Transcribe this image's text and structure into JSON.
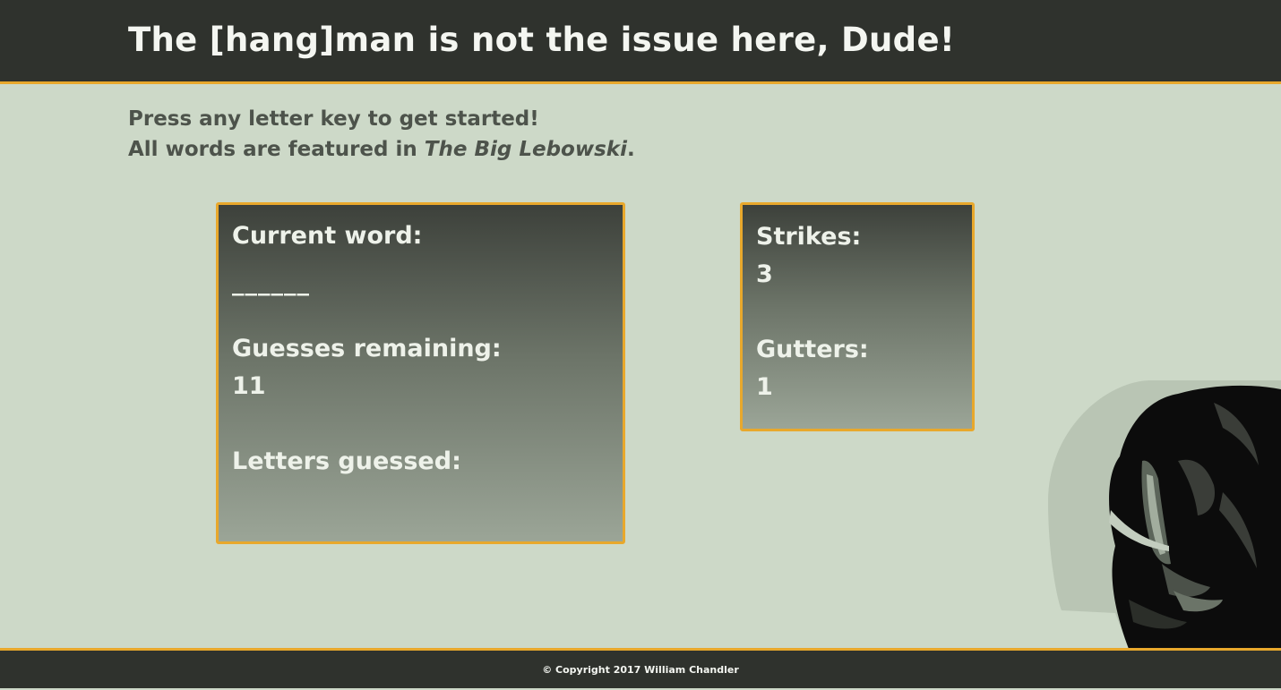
{
  "header": {
    "title": "The [hang]man is not the issue here, Dude!"
  },
  "intro": {
    "line1": "Press any letter key to get started!",
    "line2_prefix": "All words are featured in ",
    "line2_movie": "The Big Lebowski",
    "line2_suffix": "."
  },
  "game": {
    "current_word_label": "Current word:",
    "current_word_value": "______",
    "guesses_remaining_label": "Guesses remaining:",
    "guesses_remaining_value": "11",
    "letters_guessed_label": "Letters guessed:",
    "letters_guessed_value": ""
  },
  "stats": {
    "strikes_label": "Strikes:",
    "strikes_value": "3",
    "gutters_label": "Gutters:",
    "gutters_value": "1"
  },
  "footer": {
    "copyright": "© Copyright 2017 William Chandler"
  },
  "colors": {
    "background": "#cdd9c8",
    "header_bg": "#2f322d",
    "accent": "#e8a82c",
    "card_text": "#eef2ea",
    "intro_text": "#4d534b"
  },
  "decoration": {
    "icon": "dude-silhouette-icon"
  }
}
